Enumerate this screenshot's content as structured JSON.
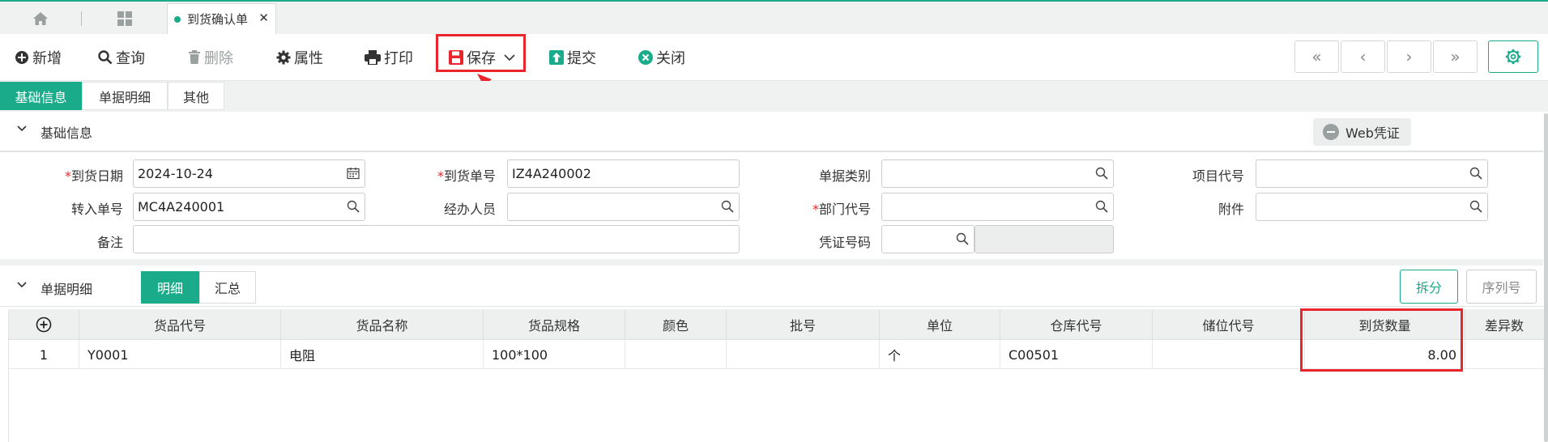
{
  "tabbar": {
    "home_icon": "home-icon",
    "apps_icon": "grid-icon",
    "doc_tab_label": "到货确认单",
    "close_glyph": "✕"
  },
  "toolbar": {
    "buttons": [
      {
        "label": "新增",
        "icon": "plus-circle-icon",
        "enabled": true
      },
      {
        "label": "查询",
        "icon": "search-icon",
        "enabled": true
      },
      {
        "label": "删除",
        "icon": "trash-icon",
        "enabled": false
      },
      {
        "label": "属性",
        "icon": "gear-icon",
        "enabled": true
      },
      {
        "label": "打印",
        "icon": "printer-icon",
        "enabled": true
      },
      {
        "label": "保存",
        "icon": "save-icon",
        "enabled": true,
        "has_dropdown": true,
        "highlighted": true
      },
      {
        "label": "提交",
        "icon": "upload-icon",
        "enabled": true
      },
      {
        "label": "关闭",
        "icon": "close-circle-icon",
        "enabled": true
      }
    ],
    "nav": [
      "«",
      "‹",
      "›",
      "»"
    ]
  },
  "info_tabs": [
    {
      "label": "基础信息",
      "active": true
    },
    {
      "label": "单据明细",
      "active": false
    },
    {
      "label": "其他",
      "active": false
    }
  ],
  "basic_section": {
    "title": "基础信息",
    "web_voucher_label": "Web凭证"
  },
  "form": {
    "arrival_date": {
      "label": "到货日期",
      "required": true,
      "value": "2024-10-24"
    },
    "arrival_no": {
      "label": "到货单号",
      "required": true,
      "value": "IZ4A240002"
    },
    "doc_type": {
      "label": "单据类别",
      "required": false,
      "value": ""
    },
    "project_code": {
      "label": "项目代号",
      "required": false,
      "value": ""
    },
    "transfer_no": {
      "label": "转入单号",
      "required": false,
      "value": "MC4A240001"
    },
    "handler": {
      "label": "经办人员",
      "required": false,
      "value": ""
    },
    "dept_code": {
      "label": "部门代号",
      "required": true,
      "value": ""
    },
    "attachment": {
      "label": "附件",
      "required": false,
      "value": ""
    },
    "remark": {
      "label": "备注",
      "required": false,
      "value": ""
    },
    "voucher_no": {
      "label": "凭证号码",
      "required": false,
      "value": ""
    }
  },
  "detail_section": {
    "title": "单据明细",
    "tabs": [
      {
        "label": "明细",
        "active": true
      },
      {
        "label": "汇总",
        "active": false
      }
    ],
    "split_label": "拆分",
    "serial_label": "序列号"
  },
  "grid": {
    "columns": [
      "货品代号",
      "货品名称",
      "货品规格",
      "颜色",
      "批号",
      "单位",
      "仓库代号",
      "储位代号",
      "到货数量",
      "差异数"
    ],
    "rows": [
      {
        "no": "1",
        "item_code": "Y0001",
        "item_name": "电阻",
        "spec": "100*100",
        "color": "",
        "batch": "",
        "unit": "个",
        "warehouse": "C00501",
        "location": "",
        "qty": "8.00"
      }
    ]
  },
  "colors": {
    "accent": "#1aab8a",
    "highlight": "#e8262b"
  }
}
